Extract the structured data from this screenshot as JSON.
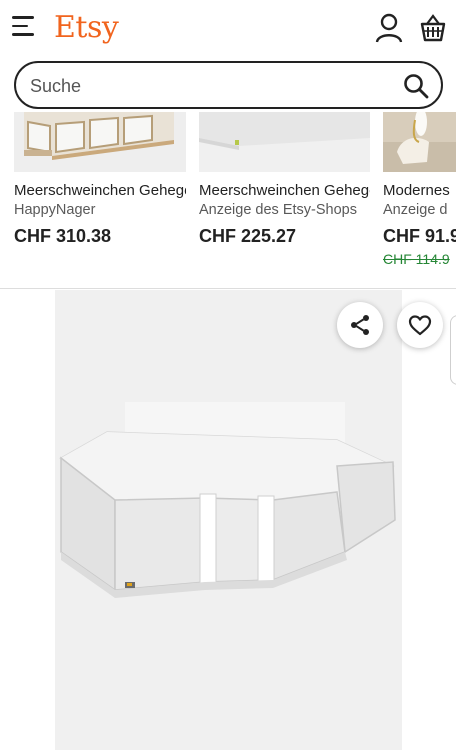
{
  "header": {
    "logo": "Etsy",
    "icons": {
      "menu": "hamburger-menu-icon",
      "account": "user-icon",
      "cart": "basket-icon"
    }
  },
  "search": {
    "placeholder": "Suche",
    "value": "",
    "icon": "search-icon"
  },
  "carousel": {
    "cards": [
      {
        "title": "Meerschweinchen Gehege",
        "shop": "HappyNager",
        "price": "CHF 310.38",
        "old_price": ""
      },
      {
        "title": "Meerschweinchen Gehege",
        "shop": "Anzeige des Etsy-Shops",
        "price": "CHF 225.27",
        "old_price": ""
      },
      {
        "title": "Modernes",
        "shop": "Anzeige d",
        "price": "CHF 91.9",
        "old_price": "CHF 114.9"
      }
    ]
  },
  "listing": {
    "share_icon": "share-icon",
    "favorite_icon": "heart-icon"
  },
  "colors": {
    "brand": "#f1641e",
    "sale_green": "#258635",
    "text": "#222222",
    "muted": "#595959"
  }
}
